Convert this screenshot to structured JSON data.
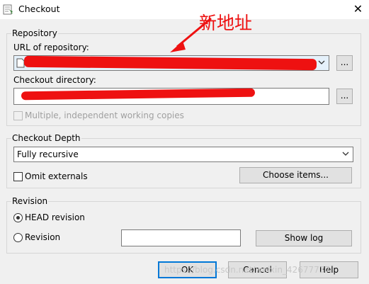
{
  "window": {
    "title": "Checkout",
    "close_glyph": "✕"
  },
  "annotation": {
    "text": "新地址",
    "color": "#ee1111"
  },
  "repository": {
    "group_label": "Repository",
    "url_label": "URL of repository:",
    "url_browse_label": "...",
    "dir_label": "Checkout directory:",
    "dir_browse_label": "...",
    "multiple_label": "Multiple, independent working copies",
    "multiple_checked": false
  },
  "depth": {
    "group_label": "Checkout Depth",
    "selected": "Fully recursive",
    "omit_label": "Omit externals",
    "omit_checked": false,
    "choose_items_label": "Choose items..."
  },
  "revision": {
    "group_label": "Revision",
    "head_label": "HEAD revision",
    "head_selected": true,
    "revision_label": "Revision",
    "revision_value": "",
    "show_log_label": "Show log"
  },
  "footer": {
    "ok_label": "OK",
    "cancel_label": "Cancel",
    "help_label": "Help",
    "watermark": "https://blog.csdn.net/weixin_42677737"
  },
  "colors": {
    "redaction": "#ee1111",
    "selection": "#e5f1fb",
    "accent": "#0078d7"
  }
}
